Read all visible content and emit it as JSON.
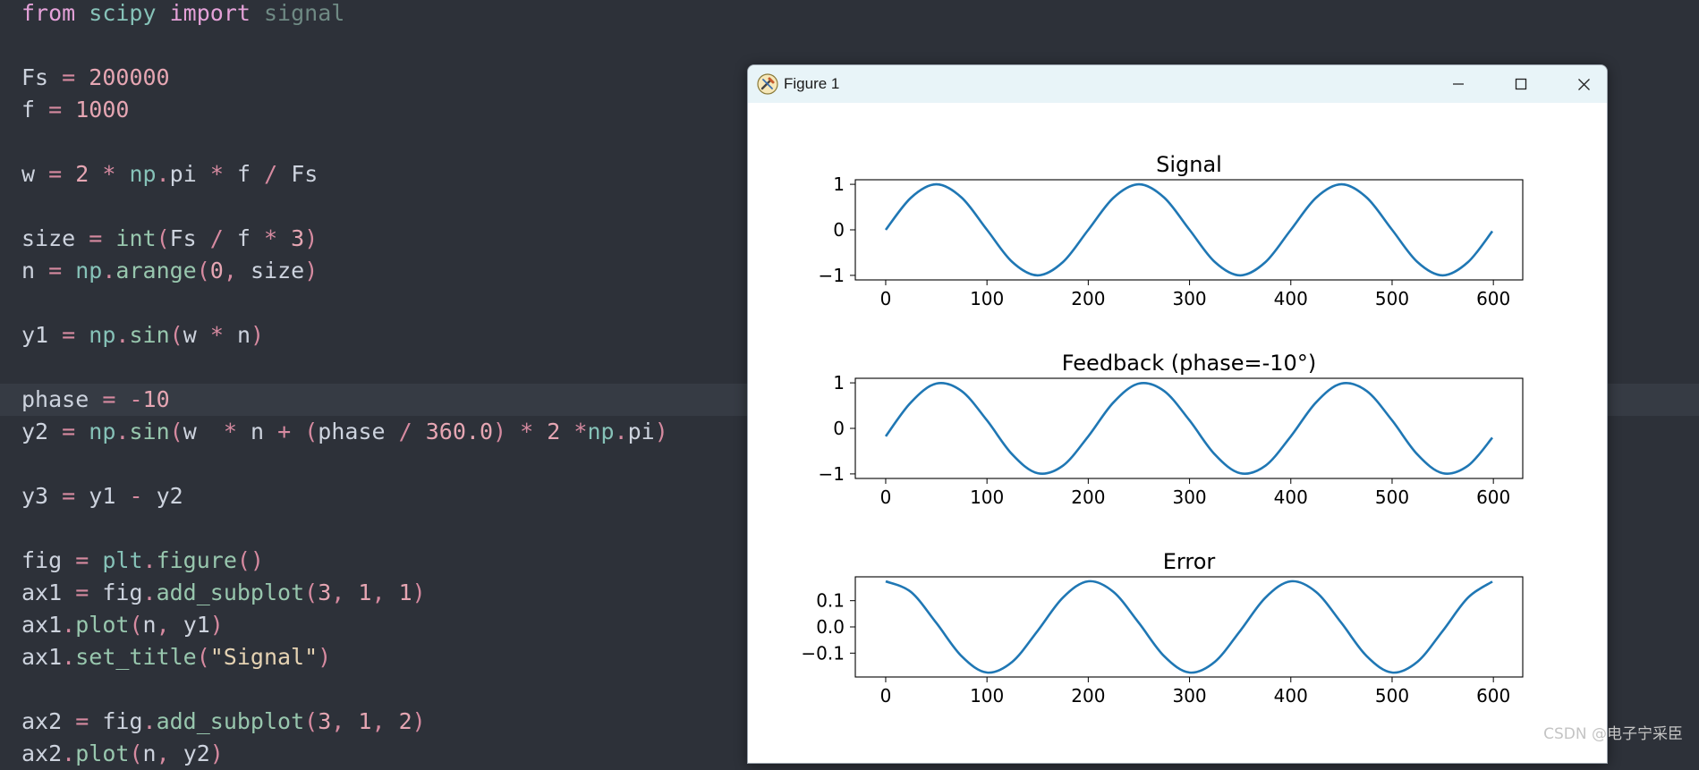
{
  "editor": {
    "current_line": 12,
    "lines": [
      [
        [
          "kw",
          "from"
        ],
        [
          "sp",
          " "
        ],
        [
          "mod",
          "scipy"
        ],
        [
          "sp",
          " "
        ],
        [
          "kw",
          "import"
        ],
        [
          "sp",
          " "
        ],
        [
          "dim",
          "signal"
        ]
      ],
      [],
      [
        [
          "id",
          "Fs"
        ],
        [
          "sp",
          " "
        ],
        [
          "op",
          "="
        ],
        [
          "sp",
          " "
        ],
        [
          "num",
          "200000"
        ]
      ],
      [
        [
          "id",
          "f"
        ],
        [
          "sp",
          " "
        ],
        [
          "op",
          "="
        ],
        [
          "sp",
          " "
        ],
        [
          "num",
          "1000"
        ]
      ],
      [],
      [
        [
          "id",
          "w"
        ],
        [
          "sp",
          " "
        ],
        [
          "op",
          "="
        ],
        [
          "sp",
          " "
        ],
        [
          "num",
          "2"
        ],
        [
          "sp",
          " "
        ],
        [
          "op",
          "*"
        ],
        [
          "sp",
          " "
        ],
        [
          "mod",
          "np"
        ],
        [
          "op",
          "."
        ],
        [
          "id",
          "pi"
        ],
        [
          "sp",
          " "
        ],
        [
          "op",
          "*"
        ],
        [
          "sp",
          " "
        ],
        [
          "id",
          "f"
        ],
        [
          "sp",
          " "
        ],
        [
          "op",
          "/"
        ],
        [
          "sp",
          " "
        ],
        [
          "id",
          "Fs"
        ]
      ],
      [],
      [
        [
          "id",
          "size"
        ],
        [
          "sp",
          " "
        ],
        [
          "op",
          "="
        ],
        [
          "sp",
          " "
        ],
        [
          "fn",
          "int"
        ],
        [
          "op",
          "("
        ],
        [
          "id",
          "Fs"
        ],
        [
          "sp",
          " "
        ],
        [
          "op",
          "/"
        ],
        [
          "sp",
          " "
        ],
        [
          "id",
          "f"
        ],
        [
          "sp",
          " "
        ],
        [
          "op",
          "*"
        ],
        [
          "sp",
          " "
        ],
        [
          "num",
          "3"
        ],
        [
          "op",
          ")"
        ]
      ],
      [
        [
          "id",
          "n"
        ],
        [
          "sp",
          " "
        ],
        [
          "op",
          "="
        ],
        [
          "sp",
          " "
        ],
        [
          "mod",
          "np"
        ],
        [
          "op",
          "."
        ],
        [
          "fn",
          "arange"
        ],
        [
          "op",
          "("
        ],
        [
          "num",
          "0"
        ],
        [
          "op",
          ","
        ],
        [
          "sp",
          " "
        ],
        [
          "id",
          "size"
        ],
        [
          "op",
          ")"
        ]
      ],
      [],
      [
        [
          "id",
          "y1"
        ],
        [
          "sp",
          " "
        ],
        [
          "op",
          "="
        ],
        [
          "sp",
          " "
        ],
        [
          "mod",
          "np"
        ],
        [
          "op",
          "."
        ],
        [
          "fn",
          "sin"
        ],
        [
          "op",
          "("
        ],
        [
          "id",
          "w"
        ],
        [
          "sp",
          " "
        ],
        [
          "op",
          "*"
        ],
        [
          "sp",
          " "
        ],
        [
          "id",
          "n"
        ],
        [
          "op",
          ")"
        ]
      ],
      [],
      [
        [
          "id",
          "phase"
        ],
        [
          "sp",
          " "
        ],
        [
          "op",
          "="
        ],
        [
          "sp",
          " "
        ],
        [
          "op",
          "-"
        ],
        [
          "num",
          "10"
        ]
      ],
      [
        [
          "id",
          "y2"
        ],
        [
          "sp",
          " "
        ],
        [
          "op",
          "="
        ],
        [
          "sp",
          " "
        ],
        [
          "mod",
          "np"
        ],
        [
          "op",
          "."
        ],
        [
          "fn",
          "sin"
        ],
        [
          "op",
          "("
        ],
        [
          "id",
          "w"
        ],
        [
          "sp",
          "  "
        ],
        [
          "op",
          "*"
        ],
        [
          "sp",
          " "
        ],
        [
          "id",
          "n"
        ],
        [
          "sp",
          " "
        ],
        [
          "op",
          "+"
        ],
        [
          "sp",
          " "
        ],
        [
          "op",
          "("
        ],
        [
          "id",
          "phase"
        ],
        [
          "sp",
          " "
        ],
        [
          "op",
          "/"
        ],
        [
          "sp",
          " "
        ],
        [
          "num",
          "360.0"
        ],
        [
          "op",
          ")"
        ],
        [
          "sp",
          " "
        ],
        [
          "op",
          "*"
        ],
        [
          "sp",
          " "
        ],
        [
          "num",
          "2"
        ],
        [
          "sp",
          " "
        ],
        [
          "op",
          "*"
        ],
        [
          "mod",
          "np"
        ],
        [
          "op",
          "."
        ],
        [
          "id",
          "pi"
        ],
        [
          "op",
          ")"
        ]
      ],
      [],
      [
        [
          "id",
          "y3"
        ],
        [
          "sp",
          " "
        ],
        [
          "op",
          "="
        ],
        [
          "sp",
          " "
        ],
        [
          "id",
          "y1"
        ],
        [
          "sp",
          " "
        ],
        [
          "op",
          "-"
        ],
        [
          "sp",
          " "
        ],
        [
          "id",
          "y2"
        ]
      ],
      [],
      [
        [
          "id",
          "fig"
        ],
        [
          "sp",
          " "
        ],
        [
          "op",
          "="
        ],
        [
          "sp",
          " "
        ],
        [
          "mod",
          "plt"
        ],
        [
          "op",
          "."
        ],
        [
          "fn",
          "figure"
        ],
        [
          "op",
          "()"
        ]
      ],
      [
        [
          "id",
          "ax1"
        ],
        [
          "sp",
          " "
        ],
        [
          "op",
          "="
        ],
        [
          "sp",
          " "
        ],
        [
          "id",
          "fig"
        ],
        [
          "op",
          "."
        ],
        [
          "fn",
          "add_subplot"
        ],
        [
          "op",
          "("
        ],
        [
          "num",
          "3"
        ],
        [
          "op",
          ","
        ],
        [
          "sp",
          " "
        ],
        [
          "num",
          "1"
        ],
        [
          "op",
          ","
        ],
        [
          "sp",
          " "
        ],
        [
          "num",
          "1"
        ],
        [
          "op",
          ")"
        ]
      ],
      [
        [
          "id",
          "ax1"
        ],
        [
          "op",
          "."
        ],
        [
          "fn",
          "plot"
        ],
        [
          "op",
          "("
        ],
        [
          "id",
          "n"
        ],
        [
          "op",
          ","
        ],
        [
          "sp",
          " "
        ],
        [
          "id",
          "y1"
        ],
        [
          "op",
          ")"
        ]
      ],
      [
        [
          "id",
          "ax1"
        ],
        [
          "op",
          "."
        ],
        [
          "fn",
          "set_title"
        ],
        [
          "op",
          "("
        ],
        [
          "str",
          "\"Signal\""
        ],
        [
          "op",
          ")"
        ]
      ],
      [],
      [
        [
          "id",
          "ax2"
        ],
        [
          "sp",
          " "
        ],
        [
          "op",
          "="
        ],
        [
          "sp",
          " "
        ],
        [
          "id",
          "fig"
        ],
        [
          "op",
          "."
        ],
        [
          "fn",
          "add_subplot"
        ],
        [
          "op",
          "("
        ],
        [
          "num",
          "3"
        ],
        [
          "op",
          ","
        ],
        [
          "sp",
          " "
        ],
        [
          "num",
          "1"
        ],
        [
          "op",
          ","
        ],
        [
          "sp",
          " "
        ],
        [
          "num",
          "2"
        ],
        [
          "op",
          ")"
        ]
      ],
      [
        [
          "id",
          "ax2"
        ],
        [
          "op",
          "."
        ],
        [
          "fn",
          "plot"
        ],
        [
          "op",
          "("
        ],
        [
          "id",
          "n"
        ],
        [
          "op",
          ","
        ],
        [
          "sp",
          " "
        ],
        [
          "id",
          "y2"
        ],
        [
          "op",
          ")"
        ]
      ]
    ]
  },
  "window": {
    "title": "Figure 1",
    "app_icon": "matplotlib-tools-icon",
    "controls": [
      "minimize-icon",
      "maximize-icon",
      "close-icon"
    ],
    "titlebar_color": "#e8f4f8"
  },
  "chart_data": [
    {
      "type": "line",
      "title": "Signal",
      "xlabel": "",
      "ylabel": "",
      "x_function": "n = 0..599",
      "x": [
        0,
        25,
        50,
        75,
        100,
        125,
        150,
        175,
        200,
        225,
        250,
        275,
        300,
        325,
        350,
        375,
        400,
        425,
        450,
        475,
        500,
        525,
        550,
        575,
        599
      ],
      "y": [
        0.0,
        0.707,
        1.0,
        0.707,
        0.0,
        -0.707,
        -1.0,
        -0.707,
        0.0,
        0.707,
        1.0,
        0.707,
        0.0,
        -0.707,
        -1.0,
        -0.707,
        0.0,
        0.707,
        1.0,
        0.707,
        0.0,
        -0.707,
        -1.0,
        -0.707,
        -0.031
      ],
      "xlim": [
        -30,
        629
      ],
      "ylim": [
        -1.1,
        1.1
      ],
      "xticks": [
        "0",
        "100",
        "200",
        "300",
        "400",
        "500",
        "600"
      ],
      "yticks": [
        "1",
        "0",
        "−1"
      ],
      "grid": false,
      "color": "#1f77b4"
    },
    {
      "type": "line",
      "title": "Feedback (phase=-10°)",
      "xlabel": "",
      "ylabel": "",
      "x": [
        0,
        25,
        50,
        75,
        100,
        125,
        150,
        175,
        200,
        225,
        250,
        275,
        300,
        325,
        350,
        375,
        400,
        425,
        450,
        475,
        500,
        525,
        550,
        575,
        599
      ],
      "y": [
        -0.174,
        0.574,
        0.985,
        0.819,
        0.174,
        -0.574,
        -0.985,
        -0.819,
        -0.174,
        0.574,
        0.985,
        0.819,
        0.174,
        -0.574,
        -0.985,
        -0.819,
        -0.174,
        0.574,
        0.985,
        0.819,
        0.174,
        -0.574,
        -0.985,
        -0.819,
        -0.204
      ],
      "xlim": [
        -30,
        629
      ],
      "ylim": [
        -1.1,
        1.1
      ],
      "xticks": [
        "0",
        "100",
        "200",
        "300",
        "400",
        "500",
        "600"
      ],
      "yticks": [
        "1",
        "0",
        "−1"
      ],
      "grid": false,
      "color": "#1f77b4"
    },
    {
      "type": "line",
      "title": "Error",
      "xlabel": "",
      "ylabel": "",
      "x": [
        0,
        25,
        50,
        75,
        100,
        125,
        150,
        175,
        200,
        225,
        250,
        275,
        300,
        325,
        350,
        375,
        400,
        425,
        450,
        475,
        500,
        525,
        550,
        575,
        599
      ],
      "y": [
        0.174,
        0.133,
        0.015,
        -0.112,
        -0.174,
        -0.133,
        -0.015,
        0.112,
        0.174,
        0.133,
        0.015,
        -0.112,
        -0.174,
        -0.133,
        -0.015,
        0.112,
        0.174,
        0.133,
        0.015,
        -0.112,
        -0.174,
        -0.133,
        -0.015,
        0.112,
        0.173
      ],
      "xlim": [
        -30,
        629
      ],
      "ylim": [
        -0.191,
        0.191
      ],
      "xticks": [
        "0",
        "100",
        "200",
        "300",
        "400",
        "500",
        "600"
      ],
      "yticks": [
        "0.1",
        "0.0",
        "−0.1"
      ],
      "grid": false,
      "color": "#1f77b4"
    }
  ],
  "watermark": "CSDN @电子宁采臣"
}
